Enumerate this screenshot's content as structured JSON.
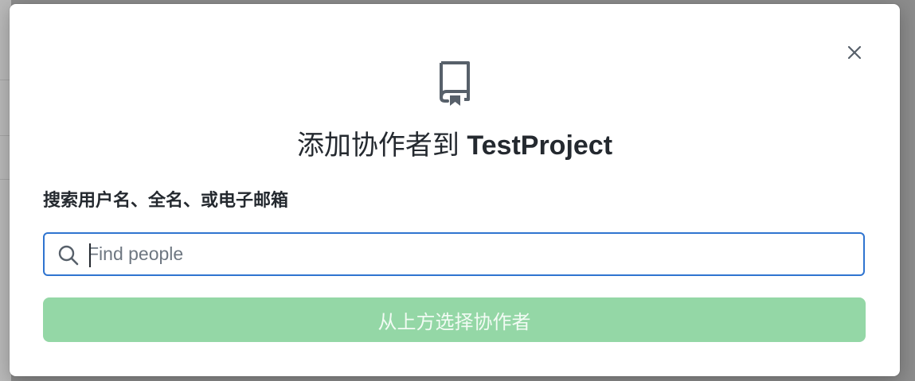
{
  "dialog": {
    "close_icon": "close-icon",
    "repo_icon": "repo-book-icon",
    "title_prefix": "添加协作者到",
    "project_name": "TestProject",
    "search_label": "搜索用户名、全名、或电子邮箱",
    "search": {
      "placeholder": "Find people",
      "value": "",
      "icon": "search-icon"
    },
    "submit_label": "从上方选择协作者",
    "submit_disabled": true
  },
  "colors": {
    "focus_border": "#2f74d0",
    "button_disabled_bg": "#94d7a6",
    "text": "#24292f",
    "icon": "#57606a"
  }
}
